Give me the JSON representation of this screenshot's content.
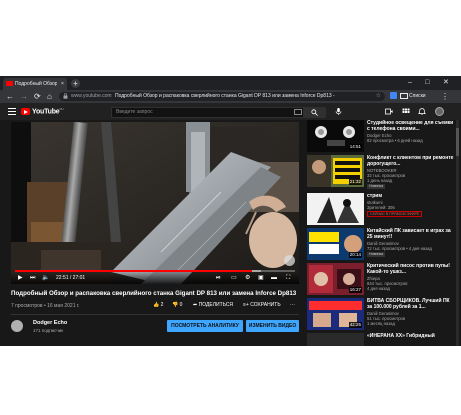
{
  "browser": {
    "tab_title": "Подробный Обзор и р",
    "tab_close": "×",
    "new_tab": "+",
    "url": "www.youtube.com",
    "page_title": "Подробный Обзор и распаковка сверлийного станка Gigant DP 813 или замена Inforce Dp813 -",
    "reading_list": "Списки",
    "back": "←",
    "forward": "→",
    "reload": "⟳",
    "home": "⌂"
  },
  "youtube": {
    "logo_text": "YouTube",
    "logo_region": "RU",
    "search_placeholder": "Введите запрос",
    "accent": "#ff0000"
  },
  "video": {
    "time": "22:51 / 27:01",
    "progress": 0.846,
    "loaded": 0.88,
    "title": "Подробный Обзор и распаковка сверлийного станка Gigant DP 813 или замена Inforce Dp813",
    "meta": "7 просмотров • 16 мая 2021 г.",
    "likes": "2",
    "dislikes": "0",
    "share": "ПОДЕЛИТЬСЯ",
    "save": "СОХРАНИТЬ",
    "more": "···",
    "channel_name": "Dodger Echo",
    "channel_subs": "171 подписчик",
    "analytics_btn": "ПОСМОТРЕТЬ АНАЛИТИКУ",
    "edit_btn": "ИЗМЕНИТЬ ВИДЕО"
  },
  "recommendations": [
    {
      "title": "Студийное освещение для съемки с телефона своими...",
      "channel": "Dodger Echo",
      "stats": "82 просмотра • 6 дней назад",
      "duration": "14:51",
      "badge": ""
    },
    {
      "title": "Конфликт с клиентом при ремонте дорогущего...",
      "channel": "NOTEBOOKER",
      "stats": "32 тыс. просмотров",
      "stats2": "1 день назад",
      "duration": "21:32",
      "badge": "Новинка"
    },
    {
      "title": "стрим",
      "channel": "stutkumi",
      "stats": "Зрителей: 306",
      "duration": "",
      "live": "СЕЙЧАС В ПРЯМОМ ЭФИРЕ"
    },
    {
      "title": "Китайский ПК зависает в играх за 25 минут!!",
      "channel": "Daniil Gerasimov",
      "stats": "72 тыс. просмотров • 4 дня назад",
      "duration": "20:14",
      "badge": "Новинка"
    },
    {
      "title": "Критический писос против пупы! Какой-то ушкз...",
      "channel": "Zhiepa",
      "stats": "844 тыс. просмотров",
      "stats2": "4 дня назад",
      "duration": "16:27",
      "badge": ""
    },
    {
      "title": "БИТВА СБОРЩИКОВ. Лучший ПК за 100.000 рублей за 1...",
      "channel": "Daniil Gerasimov",
      "stats": "51 тыс. просмотров",
      "stats2": "1 месяц назад",
      "duration": "42:25",
      "badge": ""
    },
    {
      "title": "«ИНЕРАНА XX» Гибридный",
      "channel": "",
      "stats": "",
      "duration": "",
      "badge": ""
    }
  ]
}
